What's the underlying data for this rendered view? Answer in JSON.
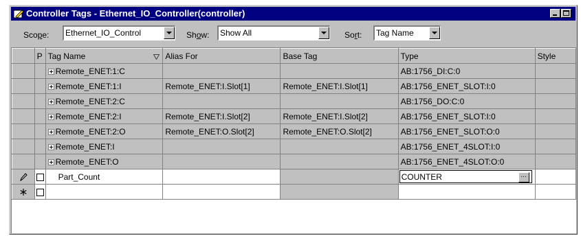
{
  "window": {
    "title": "Controller Tags - Ethernet_IO_Controller(controller)",
    "title_bg": "#000080"
  },
  "toolbar": {
    "scope_label_pre": "Sco",
    "scope_label_ul": "p",
    "scope_label_post": "e:",
    "scope_value": "Ethernet_IO_Control",
    "show_label_pre": "Sh",
    "show_label_ul": "o",
    "show_label_post": "w:",
    "show_value": "Show All",
    "sort_label_pre": "So",
    "sort_label_ul": "r",
    "sort_label_post": "t:",
    "sort_value": "Tag Name"
  },
  "columns": {
    "p": "P",
    "tag_name": "Tag Name",
    "alias_for": "Alias For",
    "base_tag": "Base Tag",
    "type": "Type",
    "style": "Style"
  },
  "rows": [
    {
      "tag": "Remote_ENET:1:C",
      "alias": "",
      "base": "",
      "type": "AB:1756_DI:C:0"
    },
    {
      "tag": "Remote_ENET:1:I",
      "alias": "Remote_ENET:I.Slot[1]",
      "base": "Remote_ENET:I.Slot[1]",
      "type": "AB:1756_ENET_SLOT:I:0"
    },
    {
      "tag": "Remote_ENET:2:C",
      "alias": "",
      "base": "",
      "type": "AB:1756_DO:C:0"
    },
    {
      "tag": "Remote_ENET:2:I",
      "alias": "Remote_ENET:I.Slot[2]",
      "base": "Remote_ENET:I.Slot[2]",
      "type": "AB:1756_ENET_SLOT:I:0"
    },
    {
      "tag": "Remote_ENET:2:O",
      "alias": "Remote_ENET:O.Slot[2]",
      "base": "Remote_ENET:O.Slot[2]",
      "type": "AB:1756_ENET_SLOT:O:0"
    },
    {
      "tag": "Remote_ENET:I",
      "alias": "",
      "base": "",
      "type": "AB:1756_ENET_4SLOT:I:0"
    },
    {
      "tag": "Remote_ENET:O",
      "alias": "",
      "base": "",
      "type": "AB:1756_ENET_4SLOT:O:0"
    }
  ],
  "edit_row": {
    "tag": "Part_Count",
    "type": "COUNTER",
    "ellipsis": "..."
  },
  "icons": {
    "app": "controller-tags-icon",
    "edit": "pencil-icon",
    "new": "asterisk-icon",
    "expand": "plus-box-icon",
    "sort": "sort-down-triangle-icon"
  }
}
